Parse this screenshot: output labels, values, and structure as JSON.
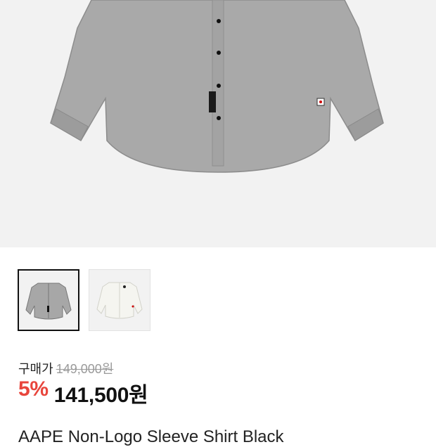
{
  "gallery": {
    "thumbnails": [
      {
        "variant": "gray",
        "selected": true
      },
      {
        "variant": "white",
        "selected": false
      }
    ]
  },
  "price": {
    "buy_label": "구매가",
    "original": "149,000원",
    "discount": "5%",
    "sale": "141,500원"
  },
  "product": {
    "name": "AAPE Non-Logo Sleeve Shirt Black"
  },
  "colors": {
    "accent_discount": "#e8453c",
    "shirt_gray": "#a7a7a7",
    "shirt_white": "#f5f5f0"
  }
}
